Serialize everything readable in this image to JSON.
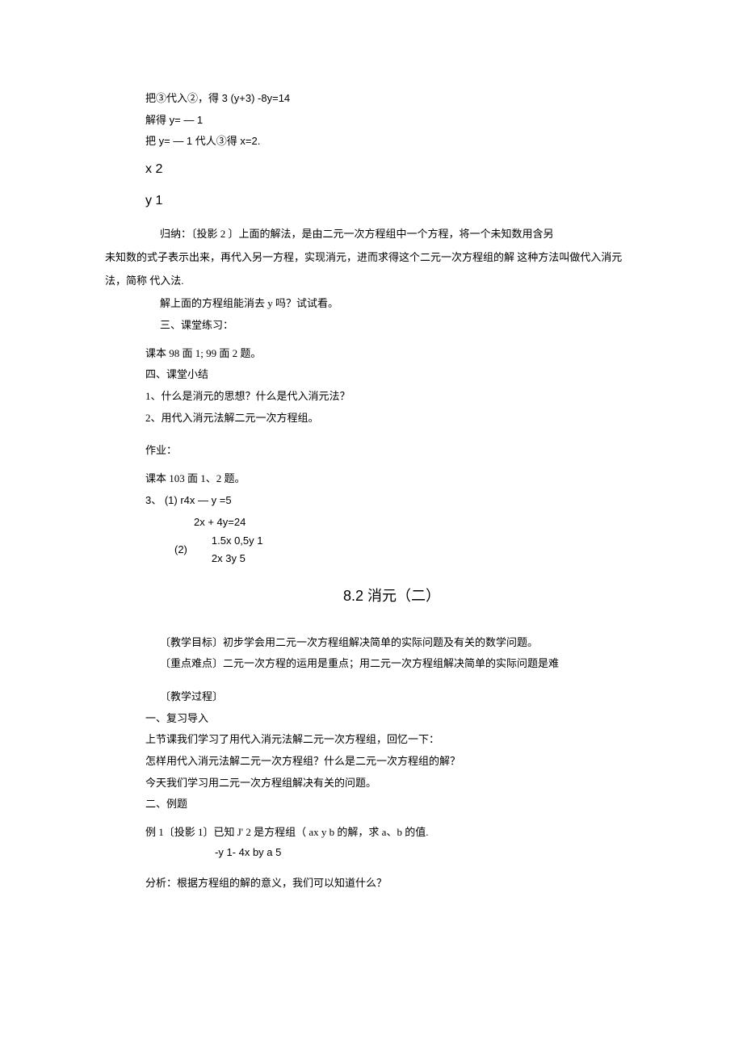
{
  "top": {
    "l1": "把③代入②，得 3 (y+3) -8y=14",
    "l2": "解得 y= — 1",
    "l3": "把 y= — 1 代人③得 x=2.",
    "l4": "x 2",
    "l5": "y 1"
  },
  "para1": "归纳：〔投影 2 〕上面的解法，是由二元一次方程组中一个方程，将一个未知数用含另",
  "para2": "未知数的式子表示出来，再代入另一方程，实现消元，进而求得这个二元一次方程组的解 这种方法叫做代入消元法，简称 代入法.",
  "q1": "解上面的方程组能消去 y 吗？试试看。",
  "s3": "三、课堂练习：",
  "ex1": "课本 98 面 1; 99 面 2 题。",
  "s4": "四、课堂小结",
  "sum1": "1、什么是消元的思想？什么是代入消元法？",
  "sum2": "2、用代入消元法解二元一次方程组。",
  "hw_label": "作业：",
  "hw1": "课本 103 面 1、2 题。",
  "hw2": "3、 (1) r4x — y =5",
  "hw2b": "2x + 4y=24",
  "eq2_label": "(2)",
  "eq2_l1": "1.5x 0,5y 1",
  "eq2_l2": "2x 3y 5",
  "title2": "8.2 消元（二）",
  "goal": "〔教学目标〕初步学会用二元一次方程组解决简单的实际问题及有关的数学问题。",
  "focus": "〔重点难点〕二元一次方程的运用是重点；用二元一次方程组解决简单的实际问题是难",
  "proc": "〔教学过程〕",
  "r1": "一、复习导入",
  "r2": "上节课我们学习了用代入消元法解二元一次方程组，回忆一下：",
  "r3": "怎样用代入消元法解二元一次方程组？什么是二元一次方程组的解？",
  "r4": "今天我们学习用二元一次方程组解决有关的问题。",
  "r5": "二、例题",
  "ex_main": "例 1〔投影 1〕已知 J' 2 是方程组（ ax y b 的解，求 a、b 的值.",
  "ex_sub": "-y 1- 4x by a 5",
  "analysis": "分析：根据方程组的解的意义，我们可以知道什么？"
}
